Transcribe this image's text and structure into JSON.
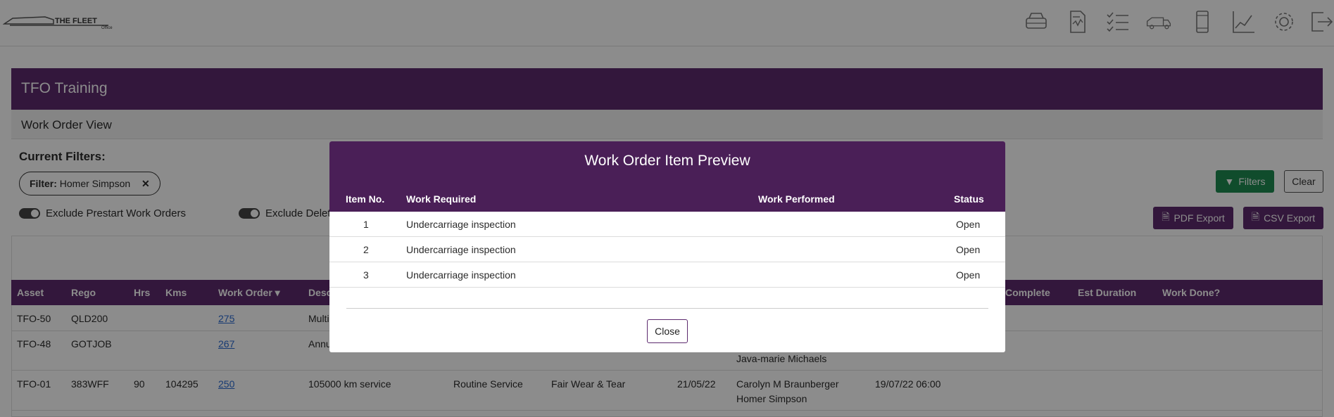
{
  "app": {
    "logo_text": "THE FLEET Office"
  },
  "nav_icons": [
    "vehicle-icon",
    "document-icon",
    "checklist-icon",
    "truck-icon",
    "mobile-icon",
    "chart-icon",
    "gear-icon",
    "logout-icon"
  ],
  "panel": {
    "title": "TFO Training",
    "subtitle": "Work Order View"
  },
  "filters": {
    "heading": "Current Filters:",
    "pill_label": "Filter:",
    "pill_value": "Homer Simpson",
    "pill_remove": "✕",
    "toggle_prestart": "Exclude Prestart Work Orders",
    "toggle_deleted": "Exclude Delete"
  },
  "buttons": {
    "filters": "Filters",
    "clear": "Clear",
    "pdf_export": "PDF Export",
    "csv_export": "CSV Export"
  },
  "table": {
    "headers": {
      "asset": "Asset",
      "rego": "Rego",
      "hrs": "Hrs",
      "kms": "Kms",
      "work_order": "Work Order",
      "desc": "Desc",
      "complete": "Complete",
      "est_duration": "Est Duration",
      "work_done": "Work Done?"
    },
    "rows": [
      {
        "asset": "TFO-50",
        "rego": "QLD200",
        "hrs": "",
        "kms": "",
        "work_order": "275",
        "desc": "Multi",
        "type": "",
        "reason": "",
        "date": "",
        "people": "",
        "people2": "",
        "datetime": ""
      },
      {
        "asset": "TFO-48",
        "rego": "GOTJOB",
        "hrs": "",
        "kms": "",
        "work_order": "267",
        "desc": "Annu",
        "type": "",
        "reason": "",
        "date": "",
        "people": "",
        "people2": "Java-marie Michaels",
        "datetime": ""
      },
      {
        "asset": "TFO-01",
        "rego": "383WFF",
        "hrs": "90",
        "kms": "104295",
        "work_order": "250",
        "desc": "105000 km service",
        "type": "Routine Service",
        "reason": "Fair Wear & Tear",
        "date": "21/05/22",
        "people": "Carolyn M Braunberger",
        "people2": "Homer Simpson",
        "datetime": "19/07/22 06:00"
      }
    ]
  },
  "modal": {
    "title": "Work Order Item Preview",
    "headers": {
      "item_no": "Item No.",
      "work_required": "Work Required",
      "work_performed": "Work Performed",
      "status": "Status"
    },
    "items": [
      {
        "no": "1",
        "work_required": "Undercarriage inspection",
        "work_performed": "",
        "status": "Open"
      },
      {
        "no": "2",
        "work_required": "Undercarriage inspection",
        "work_performed": "",
        "status": "Open"
      },
      {
        "no": "3",
        "work_required": "Undercarriage inspection",
        "work_performed": "",
        "status": "Open"
      }
    ],
    "close": "Close"
  },
  "colors": {
    "brand_purple": "#5d2a6e",
    "modal_purple": "#4a1f57",
    "filter_green": "#1e8a50",
    "link_blue": "#2a6bd1"
  }
}
